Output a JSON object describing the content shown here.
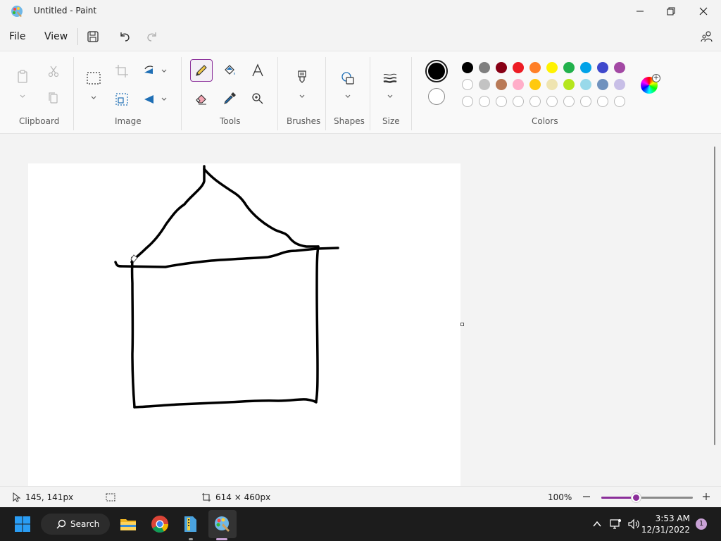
{
  "window": {
    "title": "Untitled - Paint"
  },
  "menu": {
    "file": "File",
    "view": "View"
  },
  "ribbon": {
    "groups": {
      "clipboard": "Clipboard",
      "image": "Image",
      "tools": "Tools",
      "brushes": "Brushes",
      "shapes": "Shapes",
      "size": "Size",
      "colors": "Colors"
    },
    "palette": {
      "row1": [
        "#000000",
        "#7f7f7f",
        "#880015",
        "#ed1c24",
        "#ff7f27",
        "#fff200",
        "#22b14c",
        "#00a2e8",
        "#3f48cc",
        "#a349a4"
      ],
      "row2": [
        "#ffffff",
        "#c3c3c3",
        "#b97a57",
        "#ffaec9",
        "#ffc90e",
        "#efe4b0",
        "#b5e61d",
        "#99d9ea",
        "#7092be",
        "#c8bfe7"
      ],
      "row3_count": 10
    },
    "primary_color": "#000000",
    "secondary_color": "#ffffff",
    "accent_color": "#8b2f9a"
  },
  "status": {
    "cursor_pos": "145, 141px",
    "canvas_size": "614 × 460px",
    "zoom": "100%",
    "zoom_fraction": 0.38
  },
  "taskbar": {
    "search_label": "Search",
    "time": "3:53 AM",
    "date": "12/31/2022",
    "notification_count": "1"
  }
}
